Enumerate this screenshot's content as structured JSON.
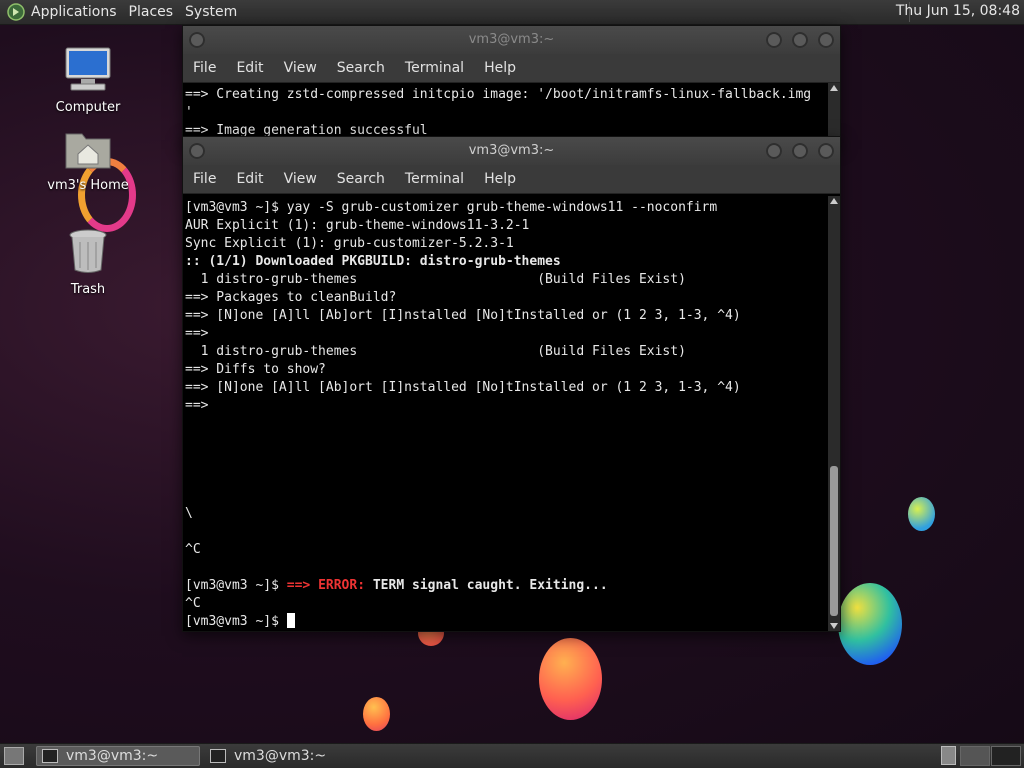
{
  "top_panel": {
    "menus": [
      "Applications",
      "Places",
      "System"
    ],
    "clock": "Thu Jun 15, 08:48"
  },
  "desktop": {
    "icons": [
      {
        "label": "Computer",
        "icon": "computer-icon"
      },
      {
        "label": "vm3's Home",
        "icon": "home-folder-icon"
      },
      {
        "label": "Trash",
        "icon": "trash-icon"
      }
    ]
  },
  "back_window": {
    "title": "vm3@vm3:~",
    "menu": [
      "File",
      "Edit",
      "View",
      "Search",
      "Terminal",
      "Help"
    ],
    "lines": [
      "==> Creating zstd-compressed initcpio image: '/boot/initramfs-linux-fallback.img",
      "'",
      "==> Image generation successful"
    ]
  },
  "front_window": {
    "title": "vm3@vm3:~",
    "menu": [
      "File",
      "Edit",
      "View",
      "Search",
      "Terminal",
      "Help"
    ],
    "lines": {
      "l1": "[vm3@vm3 ~]$ yay -S grub-customizer grub-theme-windows11 --noconfirm",
      "l2": "AUR Explicit (1): grub-theme-windows11-3.2-1",
      "l3": "Sync Explicit (1): grub-customizer-5.2.3-1",
      "l4": ":: (1/1) Downloaded PKGBUILD: distro-grub-themes",
      "l5": "  1 distro-grub-themes                       (Build Files Exist)",
      "l6": "==> Packages to cleanBuild?",
      "l7": "==> [N]one [A]ll [Ab]ort [I]nstalled [No]tInstalled or (1 2 3, 1-3, ^4)",
      "l8": "==>",
      "l9": "  1 distro-grub-themes                       (Build Files Exist)",
      "l10": "==> Diffs to show?",
      "l11": "==> [N]one [A]ll [Ab]ort [I]nstalled [No]tInstalled or (1 2 3, 1-3, ^4)",
      "l12": "==>",
      "l13": "\\",
      "l14": "^C",
      "l15_prompt": "[vm3@vm3 ~]$ ",
      "l15_arrow": "==> ",
      "l15_error": "ERROR:",
      "l15_msg": " TERM signal caught. Exiting...",
      "l16": "^C",
      "l17_prompt": "[vm3@vm3 ~]$ "
    }
  },
  "taskbar": {
    "tasks": [
      {
        "label": "vm3@vm3:~",
        "active": true
      },
      {
        "label": "vm3@vm3:~",
        "active": false
      }
    ]
  },
  "colors": {
    "error": "#ee3333",
    "panel": "#2f2f2f",
    "terminal_bg": "#000000"
  }
}
